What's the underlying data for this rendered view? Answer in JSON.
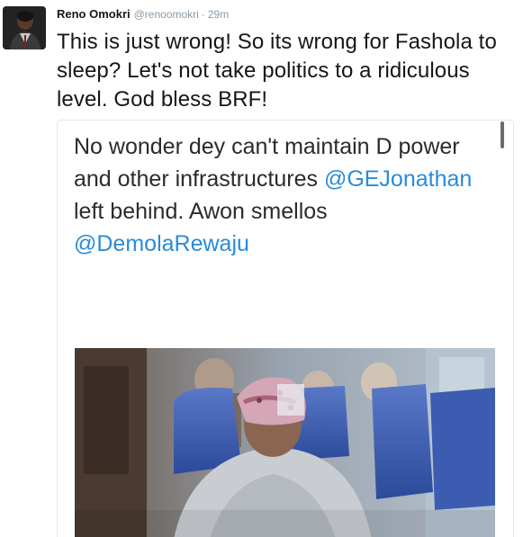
{
  "tweet": {
    "author_name": "Reno Omokri",
    "handle": "@renoomokri",
    "separator": "·",
    "time": "29m",
    "text": "This is just wrong! So its wrong for Fashola to sleep? Let's not take politics to a ridiculous level. God bless BRF!"
  },
  "quote": {
    "line1": "No wonder dey can't maintain D power and other infrastructures",
    "mention1": "@GEJonathan",
    "line2": "left behind. Awon smellos",
    "mention2": "@DemolaRewaju"
  },
  "colors": {
    "link": "#2b8bd6",
    "meta": "#8899a6",
    "text": "#14171a"
  }
}
